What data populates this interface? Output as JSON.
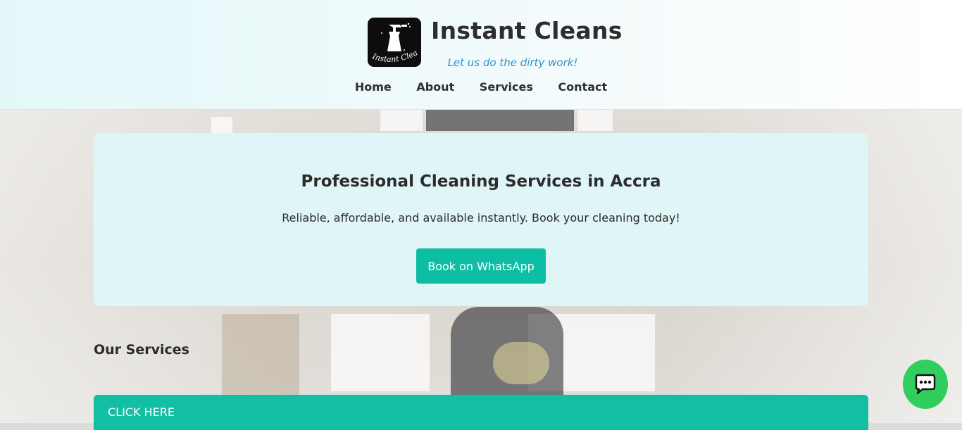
{
  "brand": {
    "name": "Instant Cleans",
    "tagline": "Let us do the dirty work!",
    "logo_text": "Instant Cleans"
  },
  "nav": {
    "items": [
      {
        "label": "Home"
      },
      {
        "label": "About"
      },
      {
        "label": "Services"
      },
      {
        "label": "Contact"
      }
    ]
  },
  "hero": {
    "title": "Professional Cleaning Services in Accra",
    "text": "Reliable, affordable, and available instantly. Book your cleaning today!",
    "button_label": "Book on WhatsApp"
  },
  "services": {
    "heading": "Our Services",
    "click_label": "CLICK HERE"
  },
  "colors": {
    "accent": "#12bfa5",
    "tagline": "#2a93c9",
    "chat": "#2fce5d"
  },
  "icons": {
    "logo": "spray-bottle-icon",
    "chat": "chat-bubble-icon"
  }
}
